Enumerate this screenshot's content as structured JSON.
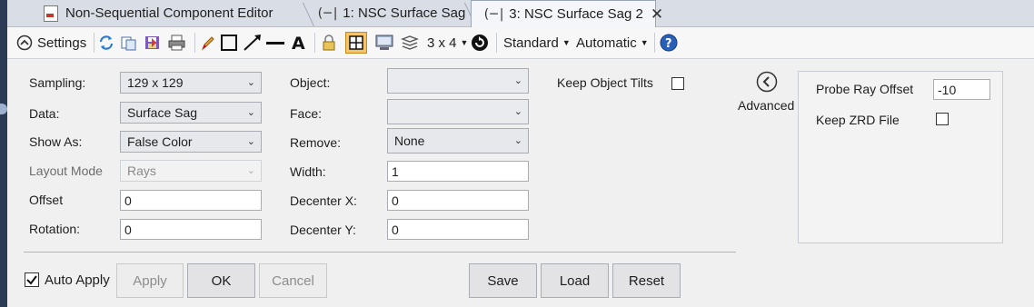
{
  "tabs": [
    {
      "label": "Non-Sequential Component Editor",
      "icon": "component-editor-icon",
      "active": false
    },
    {
      "label": "1: NSC Surface Sag",
      "icon": "surface-sag-icon",
      "active": false
    },
    {
      "label": "3: NSC Surface Sag 2",
      "icon": "surface-sag-icon",
      "active": true,
      "close_glyph": "✕"
    }
  ],
  "toolbar": {
    "settings_label": "Settings",
    "layout_label": "3 x 4",
    "standard_label": "Standard",
    "automatic_label": "Automatic",
    "icons": [
      "collapse-icon",
      "refresh-icon",
      "copy-icon",
      "save-icon",
      "print-icon",
      "pencil-icon",
      "rectangle-icon",
      "arrow-line-icon",
      "line-icon",
      "text-icon",
      "lock-icon",
      "grid-icon",
      "window-icon",
      "layers-icon",
      "reset-zoom-icon",
      "help-icon"
    ]
  },
  "form": {
    "sampling": {
      "label": "Sampling:",
      "value": "129 x 129"
    },
    "data": {
      "label": "Data:",
      "value": "Surface Sag"
    },
    "show_as": {
      "label": "Show As:",
      "value": "False Color"
    },
    "layout_mode": {
      "label": "Layout Mode",
      "value": "Rays"
    },
    "offset": {
      "label": "Offset",
      "value": "0"
    },
    "rotation": {
      "label": "Rotation:",
      "value": "0"
    },
    "object": {
      "label": "Object:",
      "value": ""
    },
    "face": {
      "label": "Face:",
      "value": ""
    },
    "remove": {
      "label": "Remove:",
      "value": "None"
    },
    "width": {
      "label": "Width:",
      "value": "1"
    },
    "decenter_x": {
      "label": "Decenter X:",
      "value": "0"
    },
    "decenter_y": {
      "label": "Decenter Y:",
      "value": "0"
    },
    "keep_object_tilts": {
      "label": "Keep Object Tilts",
      "checked": false
    }
  },
  "advanced": {
    "label": "Advanced",
    "probe_ray_offset": {
      "label": "Probe Ray Offset",
      "value": "-10"
    },
    "keep_zrd_file": {
      "label": "Keep ZRD File",
      "checked": false
    }
  },
  "buttons": {
    "auto_apply": {
      "label": "Auto Apply",
      "checked": true
    },
    "apply": "Apply",
    "ok": "OK",
    "cancel": "Cancel",
    "save": "Save",
    "load": "Load",
    "reset": "Reset"
  },
  "colors": {
    "accent": "#2a5fb8",
    "tabbar": "#d9dde5",
    "highlight": "#f5c46a"
  }
}
